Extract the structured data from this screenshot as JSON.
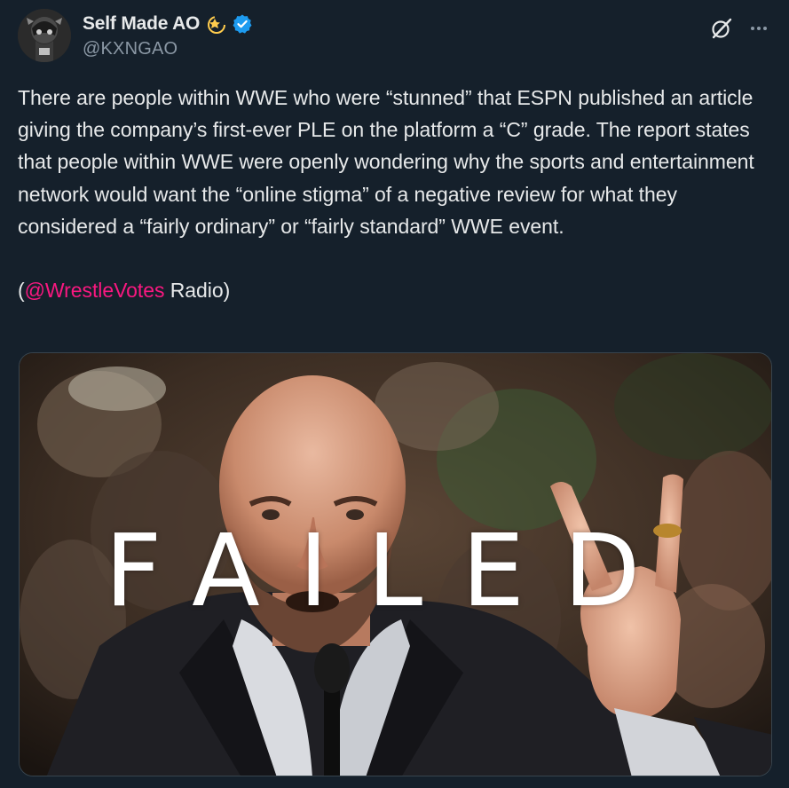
{
  "author": {
    "display_name": "Self Made AO",
    "handle": "@KXNGAO",
    "emoji_icon": "dizzy-star-icon",
    "verified_icon": "verified-badge-icon",
    "verified_color": "#1d9bf0"
  },
  "actions": {
    "grok_icon": "grok-icon",
    "more_icon": "more-options-icon"
  },
  "post": {
    "paragraph": "There are people within WWE who were “stunned” that ESPN published an article giving the company’s first-ever PLE on the platform a “C” grade. The report states that people within WWE were openly wondering why the sports and entertainment network would want the “online stigma” of a negative review for what they considered a “fairly ordinary” or “fairly standard” WWE event.",
    "credit_open": "(",
    "credit_mention": "@WrestleVotes",
    "credit_rest": " Radio)",
    "mention_color": "#f91880"
  },
  "media": {
    "caption": "FAILED"
  },
  "colors": {
    "background": "#15202b",
    "text": "#e7e9ea",
    "secondary_text": "#8b98a5"
  }
}
